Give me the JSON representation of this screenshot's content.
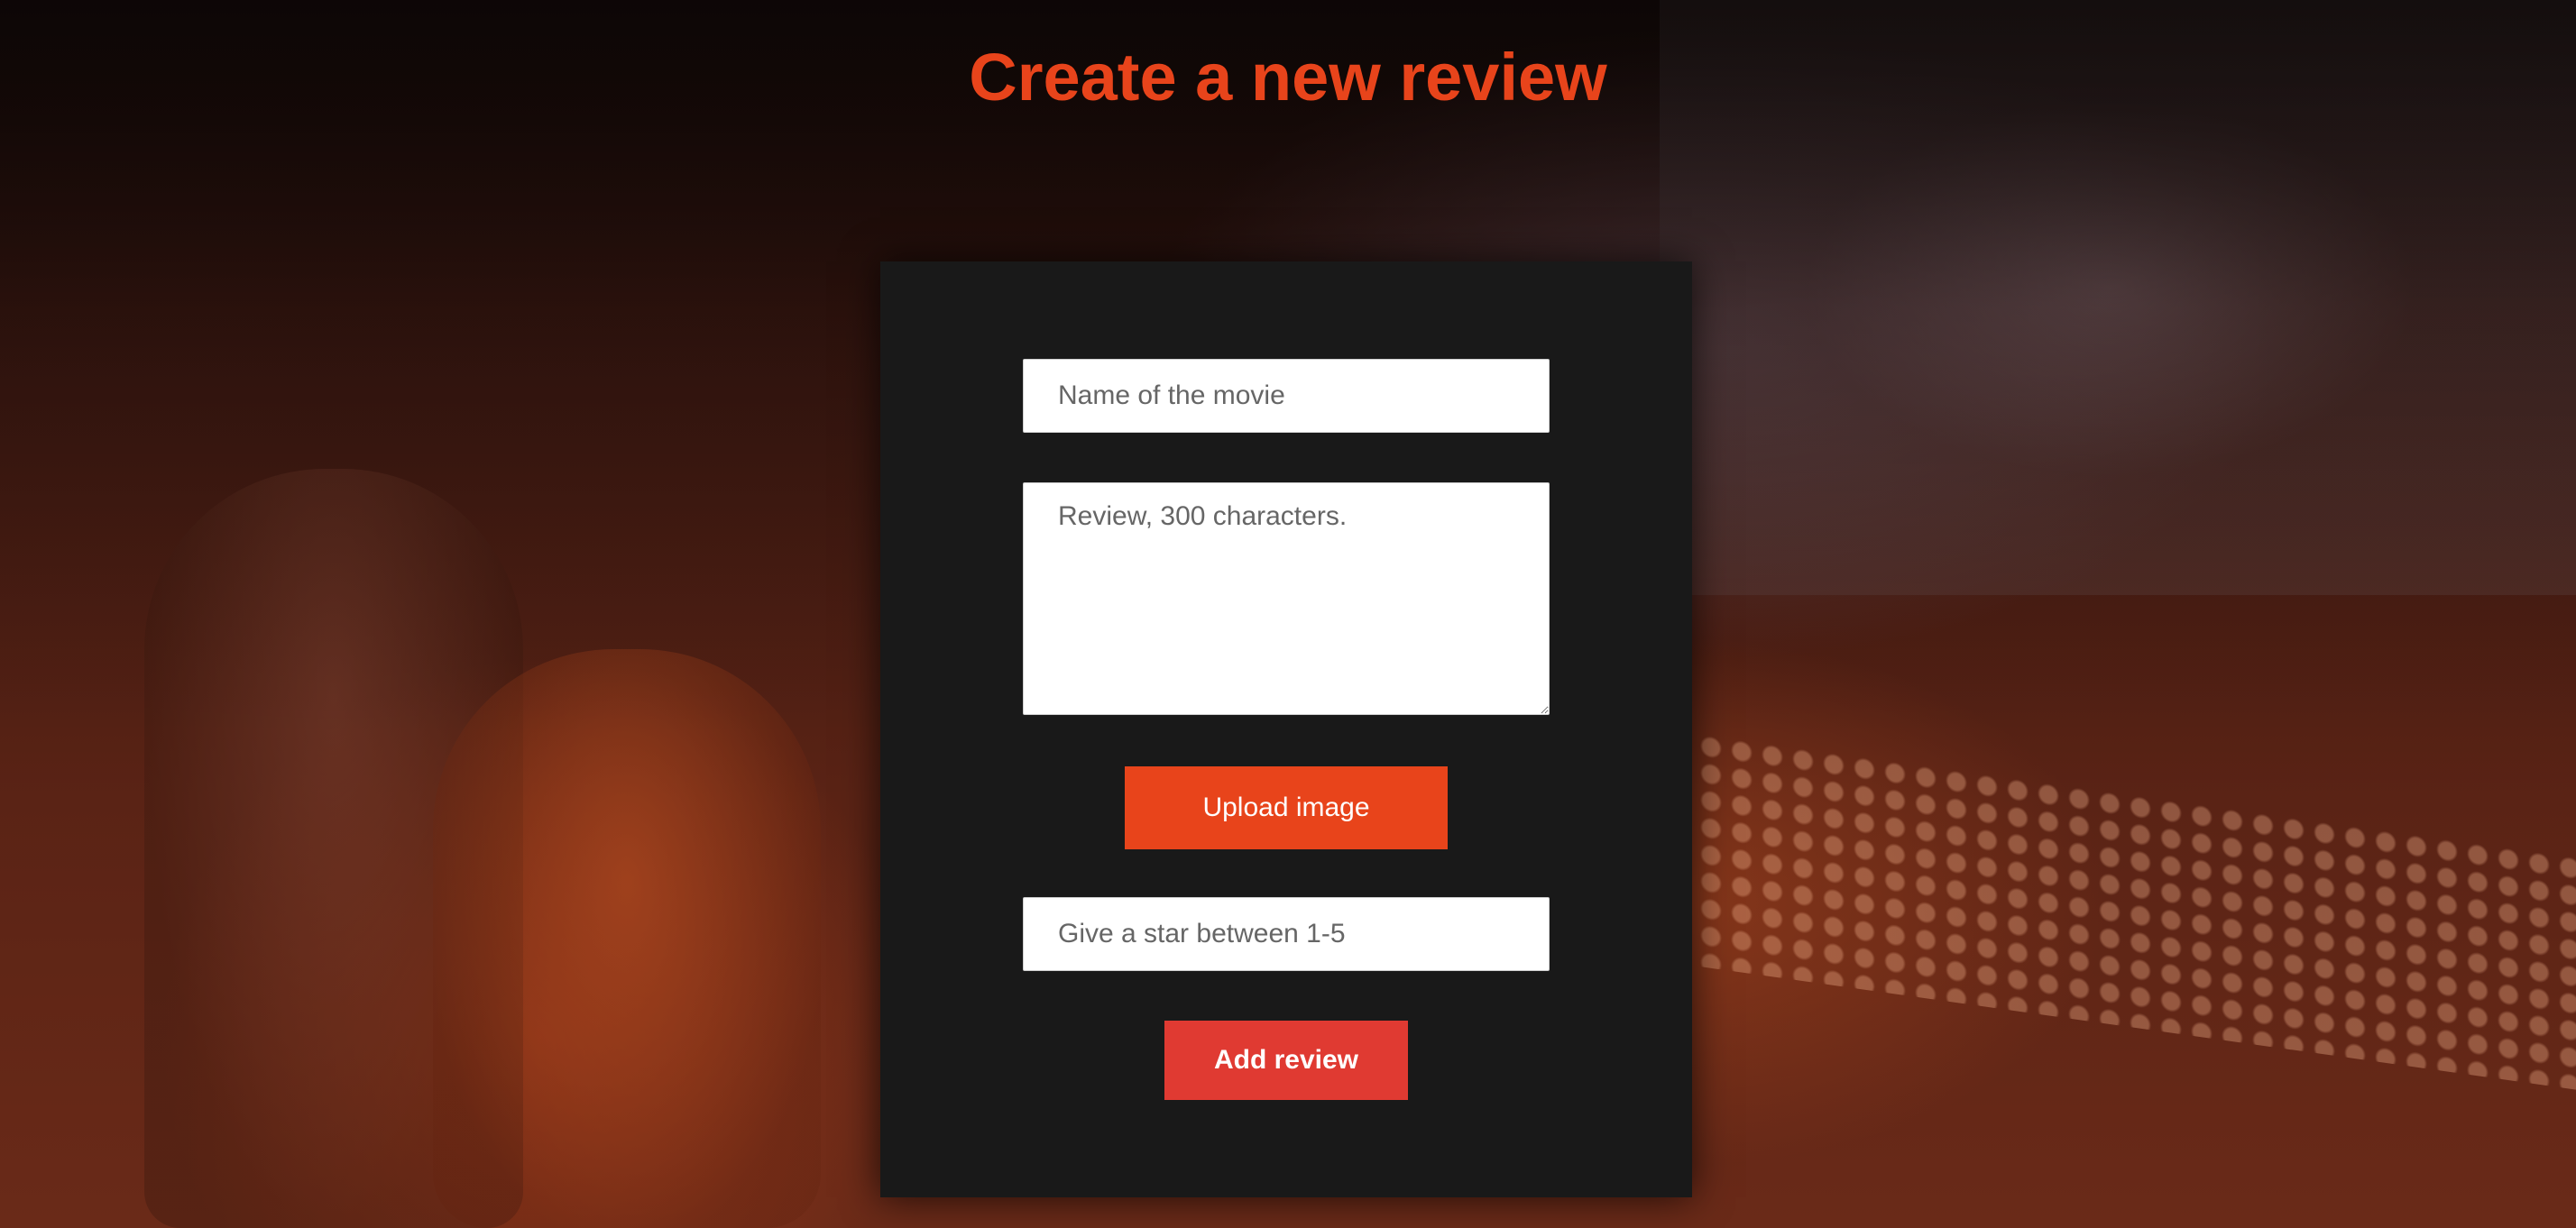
{
  "page": {
    "title": "Create a new review"
  },
  "form": {
    "movie_name": {
      "placeholder": "Name of the movie",
      "value": ""
    },
    "review": {
      "placeholder": "Review, 300 characters.",
      "value": ""
    },
    "upload_label": "Upload image",
    "stars": {
      "placeholder": "Give a star between 1-5",
      "value": ""
    },
    "submit_label": "Add review"
  },
  "colors": {
    "accent": "#e8441b",
    "submit": "#e03a32",
    "card": "#191919"
  }
}
